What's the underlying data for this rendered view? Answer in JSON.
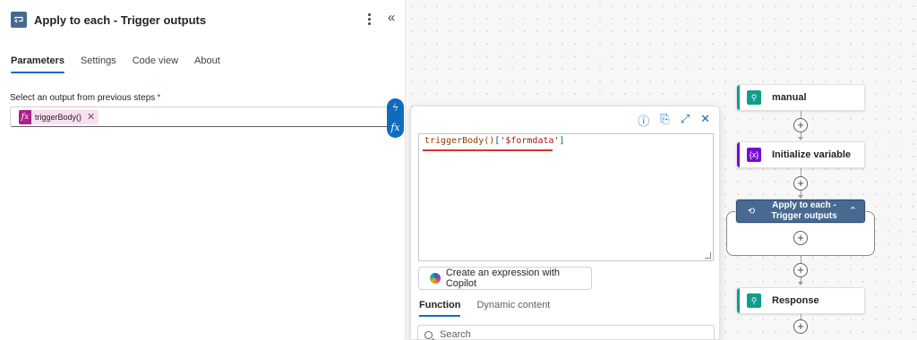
{
  "panel": {
    "title": "Apply to each - Trigger outputs",
    "icon": "loop-icon",
    "tabs": [
      "Parameters",
      "Settings",
      "Code view",
      "About"
    ],
    "active_tab": "Parameters",
    "field_label": "Select an output from previous steps",
    "required_marker": "*",
    "token": {
      "icon": "fx",
      "text": "triggerBody()"
    },
    "side_toggles": [
      "lightning-icon",
      "fx"
    ]
  },
  "expression_editor": {
    "code": {
      "fn": "triggerBody",
      "parens": "()",
      "open": "[",
      "str": "'$formdata'",
      "close": "]"
    },
    "copilot_button": "Create an expression with Copilot",
    "tabs": [
      "Function",
      "Dynamic content"
    ],
    "active_tab": "Function",
    "search_placeholder": "Search"
  },
  "flow": {
    "nodes": [
      {
        "label": "manual",
        "color": "#0f9d8a",
        "icon": "request-icon"
      },
      {
        "label": "Initialize variable",
        "color": "#770bd6",
        "icon": "variable-icon"
      },
      {
        "label": "Apply to each - Trigger outputs",
        "color": "#486991",
        "icon": "loop-icon"
      },
      {
        "label": "Response",
        "color": "#0f9d8a",
        "icon": "request-icon"
      }
    ]
  },
  "colors": {
    "accent": "#0f6cbd",
    "error_underline": "#d13438",
    "token_bg": "#f7dff1",
    "token_icon": "#ad1e8c"
  }
}
